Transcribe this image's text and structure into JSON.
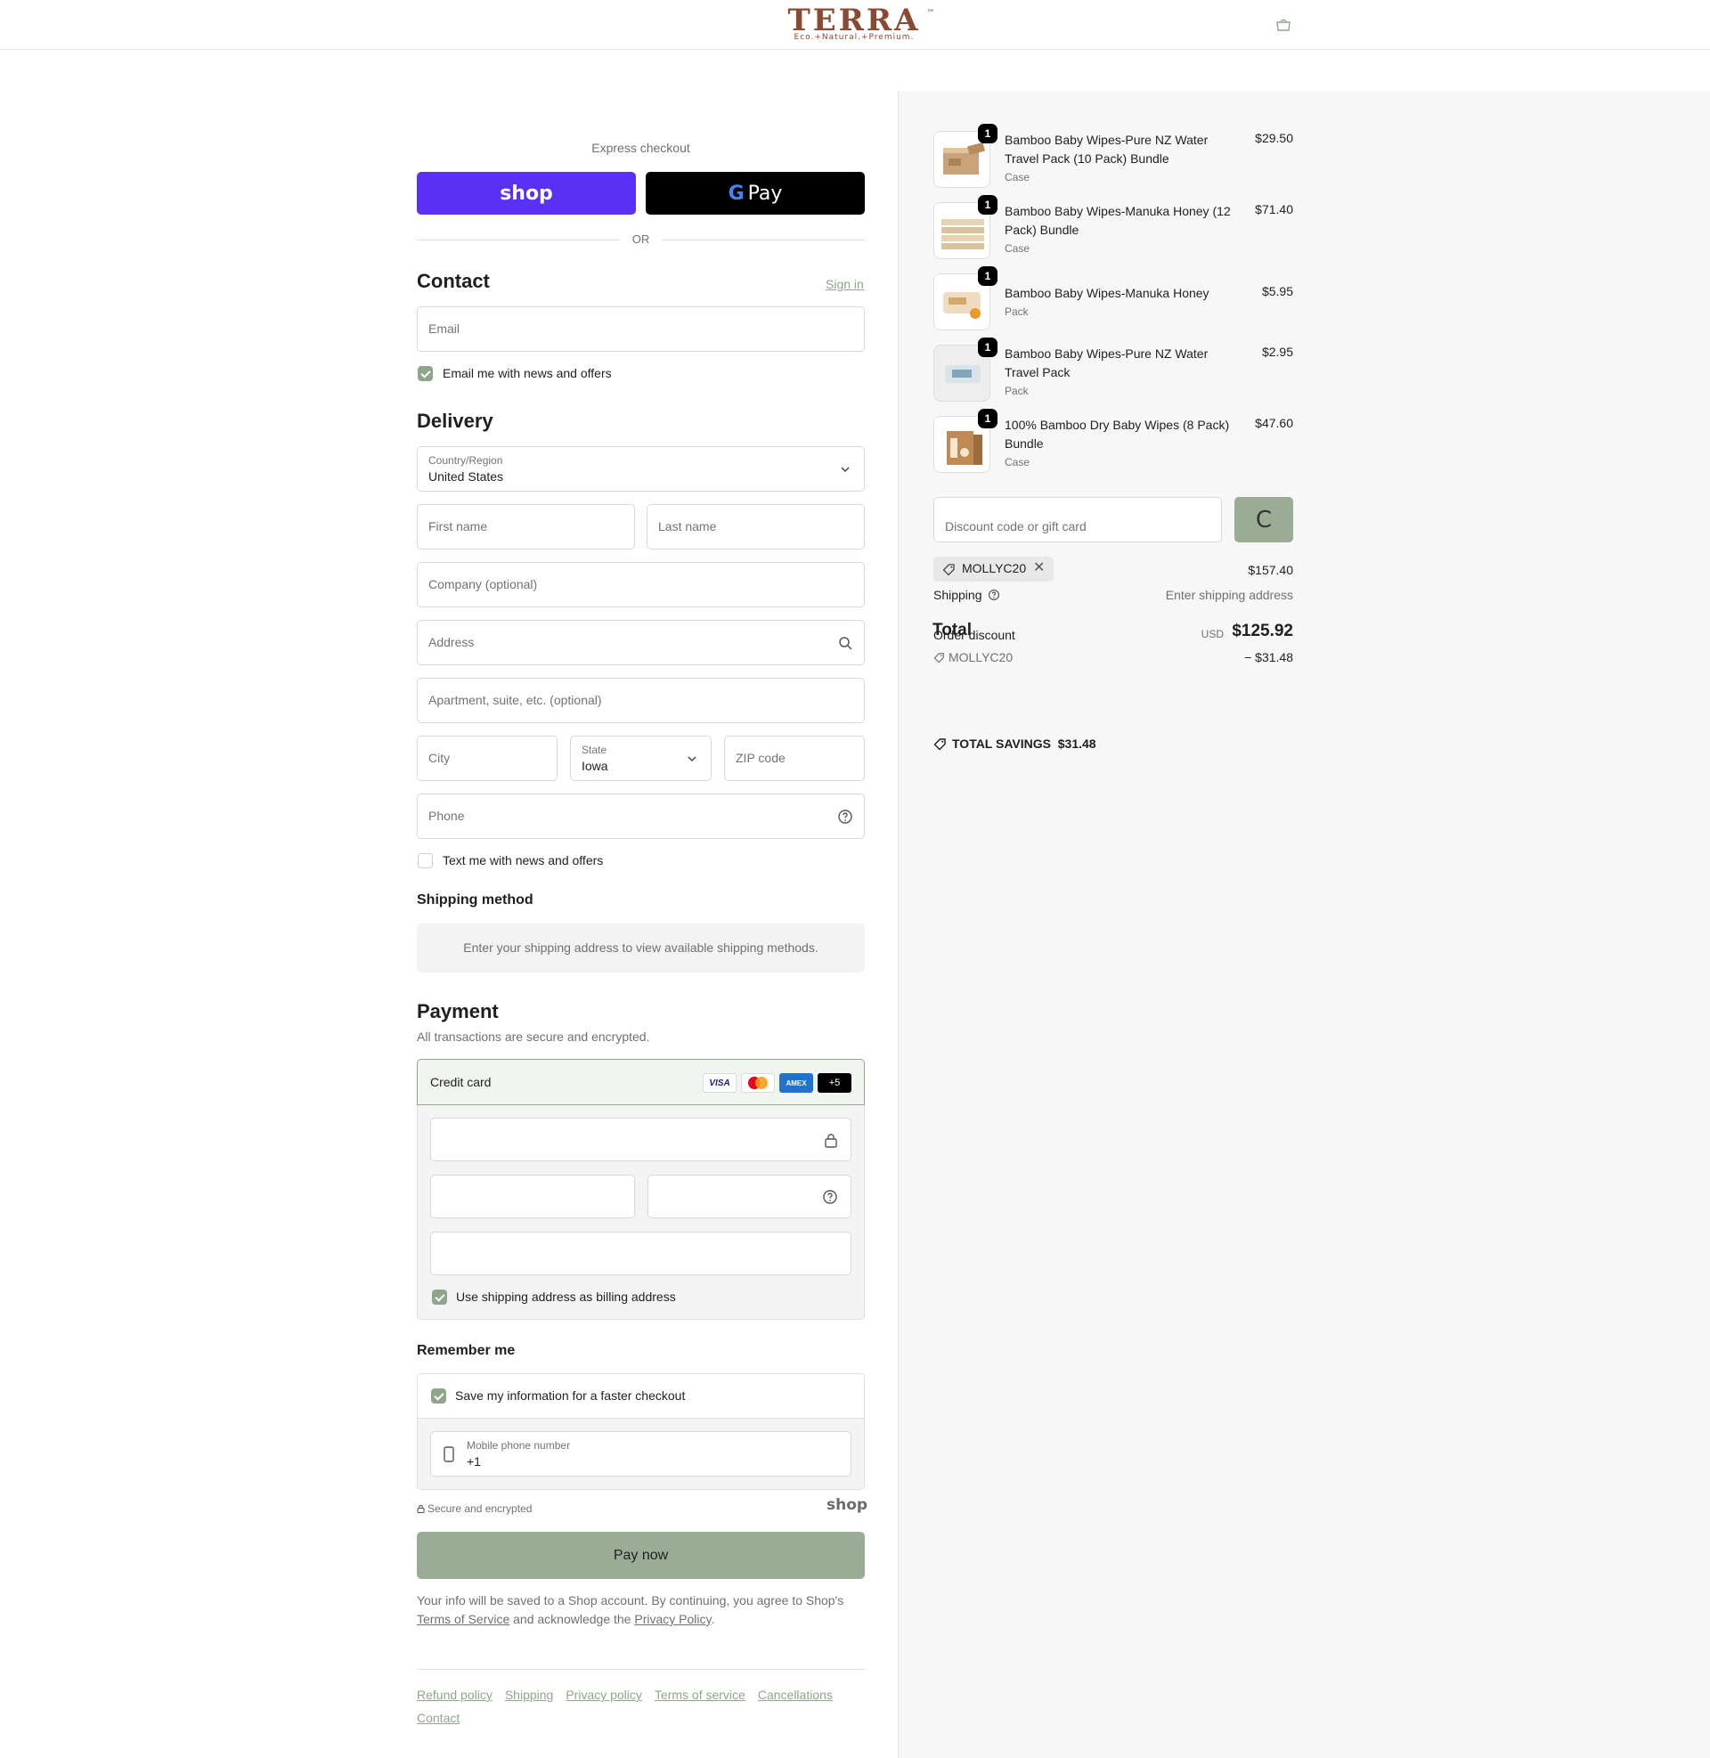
{
  "header": {
    "logo_word": "TERRA",
    "logo_tagline": "Eco.+Natural.+Premium.",
    "logo_tm": "™",
    "cart_icon": "shopping-bag-icon"
  },
  "express": {
    "label": "Express checkout",
    "shop_label": "shop",
    "gpay_g": "G",
    "gpay_label": "Pay",
    "or": "OR"
  },
  "contact": {
    "title": "Contact",
    "sign_in": "Sign in",
    "email_placeholder": "Email",
    "news_label": "Email me with news and offers",
    "news_checked": true
  },
  "delivery": {
    "title": "Delivery",
    "country_label": "Country/Region",
    "country_value": "United States",
    "first_name_placeholder": "First name",
    "last_name_placeholder": "Last name",
    "company_placeholder": "Company (optional)",
    "address_placeholder": "Address",
    "apartment_placeholder": "Apartment, suite, etc. (optional)",
    "city_placeholder": "City",
    "state_label": "State",
    "state_value": "Iowa",
    "zip_placeholder": "ZIP code",
    "phone_placeholder": "Phone",
    "text_label": "Text me with news and offers",
    "text_checked": false
  },
  "shipping_method": {
    "title": "Shipping method",
    "notice": "Enter your shipping address to view available shipping methods."
  },
  "payment": {
    "title": "Payment",
    "subtitle": "All transactions are secure and encrypted.",
    "credit_card_label": "Credit card",
    "cards": [
      "VISA",
      "mastercard",
      "AMEX",
      "+5"
    ],
    "billing_label": "Use shipping address as billing address",
    "billing_checked": true
  },
  "remember": {
    "title": "Remember me",
    "save_label": "Save my information for a faster checkout",
    "save_checked": true,
    "mobile_label": "Mobile phone number",
    "mobile_value": "+1"
  },
  "secure": {
    "text": "Secure and encrypted",
    "shop_mark": "shop"
  },
  "pay_button": "Pay now",
  "legal": {
    "before": "Your info will be saved to a Shop account. By continuing, you agree to Shop's ",
    "terms": "Terms of Service",
    "middle": " and acknowledge the ",
    "privacy": "Privacy Policy",
    "after": "."
  },
  "footer_links": [
    "Refund policy",
    "Shipping",
    "Privacy policy",
    "Terms of service",
    "Cancellations",
    "Contact"
  ],
  "items": [
    {
      "name": "Bamboo Baby Wipes-Pure NZ Water Travel Pack (10 Pack) Bundle",
      "variant": "Case",
      "price": "$29.50",
      "qty": "1"
    },
    {
      "name": "Bamboo Baby Wipes-Manuka Honey (12 Pack) Bundle",
      "variant": "Case",
      "price": "$71.40",
      "qty": "1"
    },
    {
      "name": "Bamboo Baby Wipes-Manuka Honey",
      "variant": "Pack",
      "price": "$5.95",
      "qty": "1"
    },
    {
      "name": "Bamboo Baby Wipes-Pure NZ Water Travel Pack",
      "variant": "Pack",
      "price": "$2.95",
      "qty": "1"
    },
    {
      "name": "100% Bamboo Dry Baby Wipes (8 Pack) Bundle",
      "variant": "Case",
      "price": "$47.60",
      "qty": "1"
    }
  ],
  "discount": {
    "placeholder": "Discount code or gift card",
    "apply_label": "C",
    "applied_code": "MOLLYC20"
  },
  "summary": {
    "subtotal": "$157.40",
    "shipping_label": "Shipping",
    "shipping_value": "Enter shipping address",
    "order_discount_label": "Order discount",
    "discount_code": "MOLLYC20",
    "discount_value": "− $31.48",
    "total_label": "Total",
    "currency": "USD",
    "total_value": "$125.92",
    "savings_label": "TOTAL SAVINGS",
    "savings_value": "$31.48"
  },
  "colors": {
    "accent": "#8fa68a",
    "pay_button": "#9aac96",
    "shop_purple": "#5a31f4",
    "brand": "#8a4a32"
  }
}
